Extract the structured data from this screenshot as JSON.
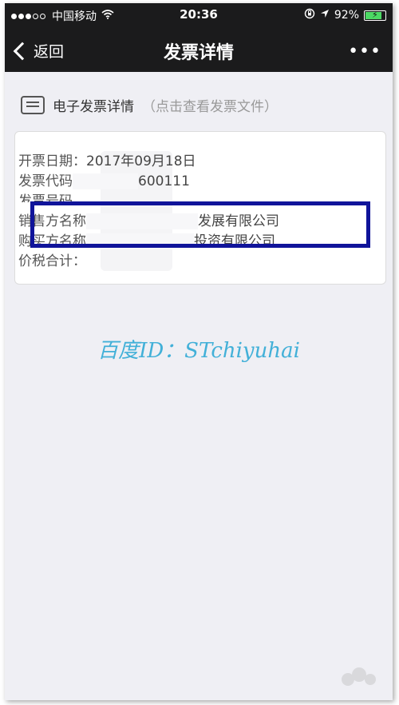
{
  "status_bar": {
    "carrier": "中国移动",
    "time": "20:36",
    "battery": "92%",
    "battery_fill": 0.92
  },
  "nav": {
    "back_label": "返回",
    "title": "发票详情",
    "more_label": "•••"
  },
  "section": {
    "title": "电子发票详情",
    "hint": "（点击查看发票文件）"
  },
  "invoice": {
    "rows": [
      {
        "label": "开票日期",
        "colon": "：",
        "value": "2017年09月18日"
      },
      {
        "label": "发票代码",
        "colon": "",
        "value": "600111"
      },
      {
        "label": "发票号码",
        "colon": "",
        "value": ""
      },
      {
        "label": "销售方名称",
        "colon": "",
        "value": "发展有限公司"
      },
      {
        "label": "购买方名称",
        "colon": "",
        "value": "投资有限公司"
      },
      {
        "label": "价税合计",
        "colon": "：",
        "value": ""
      }
    ]
  },
  "watermark": "百度ID：STchiyuhai",
  "colors": {
    "header_bg": "#1b1b1c",
    "highlight_border": "#10149a",
    "watermark": "#42b0d8",
    "battery_green": "#4cd964"
  }
}
